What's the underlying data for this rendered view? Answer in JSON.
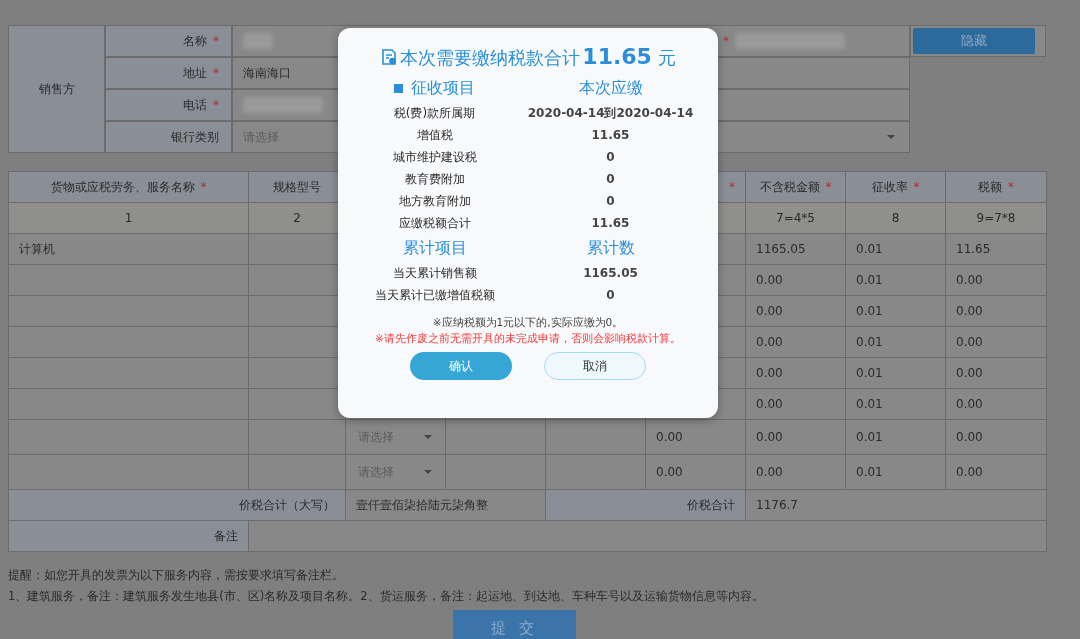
{
  "seller": {
    "group_label": "销售方",
    "hide_button": "隐藏",
    "rows": [
      {
        "label": "名称",
        "mark": "*",
        "kind": "redacted",
        "side_mark": "*"
      },
      {
        "label": "地址",
        "mark": "*",
        "kind": "text",
        "value": "海南海口"
      },
      {
        "label": "电话",
        "mark": "*",
        "kind": "redacted"
      },
      {
        "label": "银行类别",
        "kind": "select",
        "placeholder": "请选择"
      }
    ]
  },
  "items_table": {
    "header": {
      "name": {
        "label": "货物或应税劳务、服务名称",
        "mark": "*"
      },
      "spec": {
        "label": "规格型号"
      },
      "column_6": {
        "mark": "*"
      },
      "amount": {
        "label": "不含税金额",
        "mark": "*"
      },
      "rate": {
        "label": "征收率",
        "mark": "*"
      },
      "tax": {
        "label": "税额",
        "mark": "*"
      }
    },
    "index_row": {
      "name": "1",
      "spec": "2",
      "amount": "7=4*5",
      "rate": "8",
      "tax": "9=7*8"
    },
    "rows": [
      {
        "name": "计算机",
        "amount": "1165.05",
        "rate": "0.01",
        "tax": "11.65"
      },
      {
        "amount": "0.00",
        "rate": "0.01",
        "tax": "0.00"
      },
      {
        "amount": "0.00",
        "rate": "0.01",
        "tax": "0.00"
      },
      {
        "amount": "0.00",
        "rate": "0.01",
        "tax": "0.00"
      },
      {
        "amount": "0.00",
        "rate": "0.01",
        "tax": "0.00"
      },
      {
        "amount": "0.00",
        "rate": "0.01",
        "tax": "0.00"
      },
      {
        "column_3": {
          "placeholder": "请选择"
        },
        "column_6": "0.00",
        "amount": "0.00",
        "rate": "0.01",
        "tax": "0.00"
      },
      {
        "column_3": {
          "placeholder": "请选择"
        },
        "column_6": "0.00",
        "amount": "0.00",
        "rate": "0.01",
        "tax": "0.00"
      }
    ],
    "total_words_label": "价税合计（大写）",
    "total_words": "壹仟壹佰柒拾陆元柒角整",
    "total_label": "价税合计",
    "total": "1176.7",
    "remark_label": "备注"
  },
  "notes": [
    "提醒：如您开具的发票为以下服务内容，需按要求填写备注栏。",
    "1、建筑服务，备注：建筑服务发生地县(市、区)名称及项目名称。2、货运服务，备注：起运地、到达地、车种车号以及运输货物信息等内容。"
  ],
  "submit_button": "提 交",
  "dialog": {
    "title": "本次需要缴纳税款合计",
    "amount": "11.65",
    "unit": "元",
    "sections": [
      {
        "kind": "bullet",
        "item_header": "征收项目",
        "value_header": "本次应缴",
        "rows": [
          {
            "label": "税(费)款所属期",
            "value": "2020-04-14到2020-04-14"
          },
          {
            "label": "增值税",
            "value": "11.65"
          },
          {
            "label": "城市维护建设税",
            "value": "0"
          },
          {
            "label": "教育费附加",
            "value": "0"
          },
          {
            "label": "地方教育附加",
            "value": "0"
          },
          {
            "label": "应缴税额合计",
            "value": "11.65"
          }
        ]
      },
      {
        "kind": "plain",
        "item_header": "累计项目",
        "value_header": "累计数",
        "rows": [
          {
            "label": "当天累计销售额",
            "value": "1165.05"
          },
          {
            "label": "当天累计已缴增值税额",
            "value": "0"
          }
        ]
      }
    ],
    "note": "※应纳税额为1元以下的,实际应缴为0。",
    "warning": "※请先作废之前无需开具的未完成申请，否则会影响税款计算。",
    "buttons": [
      {
        "label": "确认",
        "kind": "primary"
      },
      {
        "label": "取消",
        "kind": "secondary"
      }
    ]
  }
}
